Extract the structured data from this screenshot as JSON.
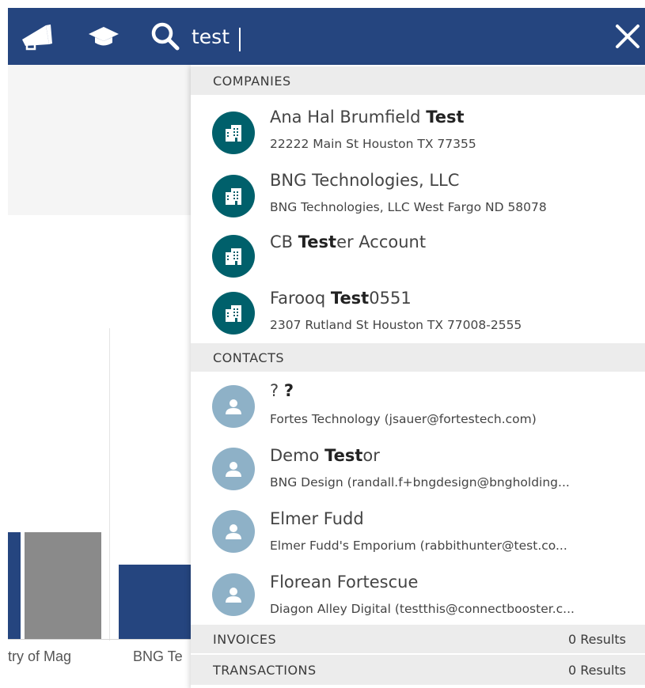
{
  "header": {
    "search_value": "test",
    "icons": [
      "megaphone-icon",
      "graduation-cap-icon",
      "search-icon",
      "close-icon"
    ]
  },
  "background_chart": {
    "category_labels": [
      "try of Mag",
      "BNG Te"
    ]
  },
  "dropdown": {
    "companies": {
      "header": "COMPANIES",
      "items": [
        {
          "title_prefix": "Ana Hal Brumfield ",
          "title_match": "Test",
          "title_suffix": "",
          "subtitle": "22222 Main St Houston TX 77355"
        },
        {
          "title_prefix": "BNG Technologies, LLC",
          "title_match": "",
          "title_suffix": "",
          "subtitle": "BNG Technologies, LLC West Fargo ND 58078"
        },
        {
          "title_prefix": "CB ",
          "title_match": "Test",
          "title_suffix": "er Account",
          "subtitle": ""
        },
        {
          "title_prefix": "Farooq ",
          "title_match": "Test",
          "title_suffix": "0551",
          "subtitle": "2307 Rutland St Houston TX 77008-2555"
        }
      ]
    },
    "contacts": {
      "header": "CONTACTS",
      "items": [
        {
          "title_prefix": "? ",
          "title_match": "?",
          "title_suffix": "",
          "subtitle": "Fortes Technology (jsauer@fortestech.com)"
        },
        {
          "title_prefix": "Demo ",
          "title_match": "Test",
          "title_suffix": "or",
          "subtitle": "BNG Design (randall.f+bngdesign@bngholding..."
        },
        {
          "title_prefix": "Elmer Fudd",
          "title_match": "",
          "title_suffix": "",
          "subtitle": "Elmer Fudd's Emporium (rabbithunter@test.co..."
        },
        {
          "title_prefix": "Florean Fortescue",
          "title_match": "",
          "title_suffix": "",
          "subtitle": "Diagon Alley Digital (testthis@connectbooster.c..."
        }
      ]
    },
    "invoices": {
      "header": "INVOICES",
      "count": "0 Results"
    },
    "transactions": {
      "header": "TRANSACTIONS",
      "count": "0 Results"
    }
  },
  "colors": {
    "header_bg": "#25457f",
    "company_avatar": "#00606b",
    "contact_avatar": "#8eb1c7",
    "section_bg": "#ececec",
    "bar_blue": "#25457f",
    "bar_gray": "#8a8a8a"
  }
}
